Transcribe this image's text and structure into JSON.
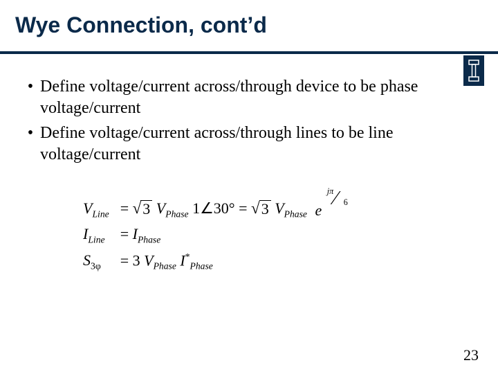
{
  "title": "Wye Connection, cont’d",
  "logo": {
    "name": "illinois-block-i-icon"
  },
  "bullets": [
    "Define voltage/current across/through device to be phase voltage/current",
    "Define voltage/current across/through lines to be line voltage/current"
  ],
  "equations": {
    "v_line_label": "V",
    "v_line_sub": "Line",
    "i_line_label": "I",
    "i_line_sub": "Line",
    "s3_label": "S",
    "s3_sub": "3φ",
    "eq_vline": "= √3 V_Phase 1∠30° = √3 V_Phase e^{jπ/6}",
    "eq_iline": "= I_Phase",
    "eq_s3": "= 3 V_Phase I*_Phase",
    "sqrt3": "3",
    "v_phase": "V",
    "phase_sub": "Phase",
    "one": "1",
    "angle": "∠",
    "deg30": "30°",
    "e": "e",
    "jpi": "jπ",
    "six": "6",
    "i_phase": "I",
    "three": "3",
    "star": "*"
  },
  "page_number": "23"
}
